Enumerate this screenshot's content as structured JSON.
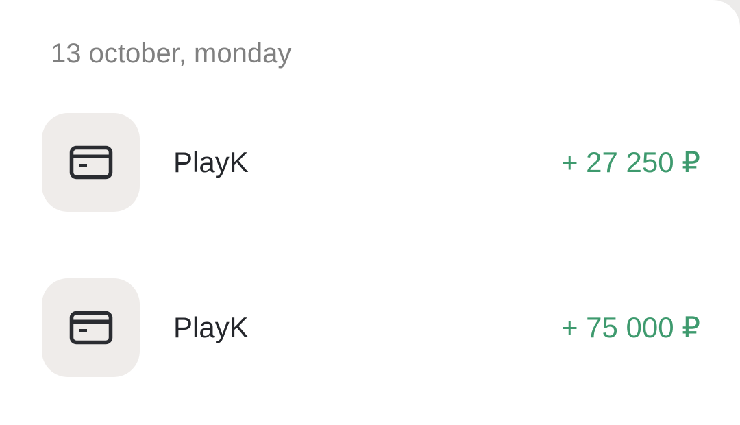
{
  "colors": {
    "income": "#3e9a6e",
    "text_primary": "#24262b",
    "text_secondary": "#808080",
    "icon_bg": "#efecea"
  },
  "section": {
    "date_label": "13 october, monday"
  },
  "transactions": [
    {
      "icon": "card-icon",
      "name": "PlayK",
      "amount": "+ 27 250 ₽"
    },
    {
      "icon": "card-icon",
      "name": "PlayK",
      "amount": "+ 75 000 ₽"
    }
  ]
}
